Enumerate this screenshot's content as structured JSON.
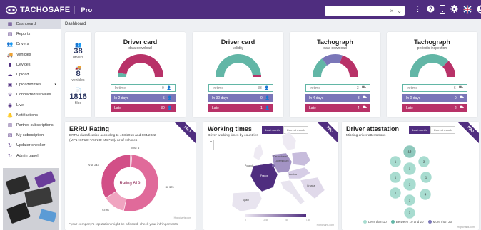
{
  "app": {
    "title": "TACHOSAFE",
    "edition": "Pro"
  },
  "header": {
    "search": {
      "placeholder": "",
      "clear_glyph": "×",
      "dropdown_glyph": "⌄"
    },
    "icons": [
      "more-vert-icon",
      "help-icon",
      "mobile-icon",
      "gear-icon",
      "flag-uk-icon",
      "user-icon"
    ]
  },
  "colors": {
    "brand": "#4f2d7f",
    "teal": "#62b6a6",
    "lavender": "#7a76b8",
    "magenta": "#b83268",
    "pink": "#e06a9a"
  },
  "sidebar": {
    "items": [
      {
        "label": "Dashboard",
        "icon": "dashboard-icon",
        "active": true
      },
      {
        "label": "Reports",
        "icon": "reports-icon"
      },
      {
        "label": "Drivers",
        "icon": "drivers-icon"
      },
      {
        "label": "Vehicles",
        "icon": "truck-icon"
      },
      {
        "label": "Devices",
        "icon": "device-icon"
      },
      {
        "label": "Upload",
        "icon": "cloud-upload-icon"
      },
      {
        "label": "Uploaded files",
        "icon": "files-icon",
        "expandable": true
      },
      {
        "label": "Connected services",
        "icon": "services-icon"
      },
      {
        "label": "Live",
        "icon": "live-icon"
      },
      {
        "label": "Notifications",
        "icon": "bell-icon"
      },
      {
        "label": "Partner subscriptions",
        "icon": "partner-icon"
      },
      {
        "label": "My subscription",
        "icon": "subscription-icon"
      },
      {
        "label": "Updater checker",
        "icon": "refresh-icon"
      },
      {
        "label": "Admin panel",
        "icon": "admin-icon"
      }
    ]
  },
  "breadcrumb": "Dashboard",
  "stats": [
    {
      "value": "38",
      "label": "drivers",
      "icon": "driver-icon"
    },
    {
      "value": "8",
      "label": "vehicles",
      "icon": "truck-icon"
    },
    {
      "value": "1816",
      "label": "files",
      "icon": "file-icon"
    }
  ],
  "gauge_cards": [
    {
      "title": "Driver card",
      "subtitle": "data download",
      "rows": [
        {
          "label": "In time",
          "value": "0",
          "icon": "person-icon"
        },
        {
          "label": "In 2 days",
          "value": "5",
          "icon": "person-icon"
        },
        {
          "label": "Late",
          "value": "30",
          "icon": "person-icon"
        }
      ],
      "fractions": [
        0.06,
        0.0,
        0.94
      ]
    },
    {
      "title": "Driver card",
      "subtitle": "validity",
      "rows": [
        {
          "label": "In time",
          "value": "33",
          "icon": "person-icon"
        },
        {
          "label": "In 30 days",
          "value": "0",
          "icon": "person-icon"
        },
        {
          "label": "Late",
          "value": "1",
          "icon": "person-icon"
        }
      ],
      "fractions": [
        0.97,
        0.0,
        0.03
      ]
    },
    {
      "title": "Tachograph",
      "subtitle": "data download",
      "rows": [
        {
          "label": "In time",
          "value": "3",
          "icon": "truck-icon"
        },
        {
          "label": "In 4 days",
          "value": "3",
          "icon": "truck-icon"
        },
        {
          "label": "Late",
          "value": "4",
          "icon": "truck-icon"
        }
      ],
      "fractions": [
        0.3,
        0.3,
        0.4
      ]
    },
    {
      "title": "Tachograph",
      "subtitle": "periodic inspection",
      "rows": [
        {
          "label": "In time",
          "value": "6",
          "icon": "truck-icon"
        },
        {
          "label": "In 0 days",
          "value": "0",
          "icon": "truck-icon"
        },
        {
          "label": "Late",
          "value": "2",
          "icon": "truck-icon"
        }
      ],
      "fractions": [
        0.75,
        0.0,
        0.25
      ]
    }
  ],
  "erru": {
    "title": "ERRU Rating",
    "desc1": "ERRU classification according to 403/2016 and 804/2022",
    "desc2": "(MP1+SP1S+VSI*20+MSI*50)/ nr of vehicles",
    "pro": "PRO",
    "center_label": "Rating 619",
    "footnote": "*your company's reputation might be affected, check your infringements",
    "credit": "Highcharts.com",
    "chart_data": {
      "type": "pie",
      "categories": [
        "MSI",
        "SI",
        "VSI",
        "MI"
      ],
      "labels": [
        "MSI: 6",
        "SI: 373",
        "SI: 91",
        "VSI: 243"
      ],
      "values": [
        6,
        373,
        91,
        243
      ]
    }
  },
  "working_times": {
    "title": "Working times",
    "subtitle": "Driver working times by countries",
    "tabs": [
      {
        "label": "Last month",
        "active": true
      },
      {
        "label": "Current month"
      }
    ],
    "pro": "PRO",
    "zoom_in": "+",
    "zoom_out": "-",
    "countries": [
      "Poland",
      "Deutschland",
      "Luxembourg",
      "France",
      "Spain",
      "Austria",
      "Croatia"
    ],
    "scale": [
      "0",
      "2.5k",
      "5k",
      "7.5k"
    ],
    "credit": "Highcharts.com"
  },
  "attestation": {
    "title": "Driver attestation",
    "subtitle": "Missing driver attestations",
    "tabs": [
      {
        "label": "Last month",
        "active": true
      },
      {
        "label": "Current month"
      }
    ],
    "pro": "PRO",
    "bubbles": [
      "13",
      "1",
      "1",
      "2",
      "1",
      "1",
      "1",
      "1",
      "4",
      "1",
      "2"
    ],
    "legend": [
      {
        "label": "Less than 10",
        "color": "#a8dcd0"
      },
      {
        "label": "Between 10 and 20",
        "color": "#62b6a6"
      },
      {
        "label": "More than 20",
        "color": "#7a76b8"
      }
    ],
    "credit": "Highcharts.com"
  }
}
